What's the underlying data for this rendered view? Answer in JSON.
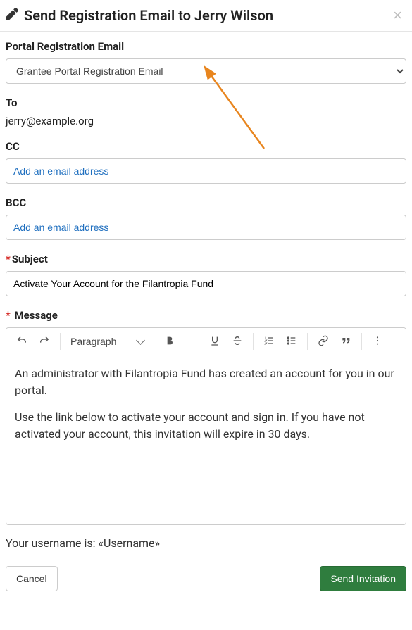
{
  "modal": {
    "title": "Send Registration Email to Jerry Wilson"
  },
  "form": {
    "portal_label": "Portal Registration Email",
    "portal_selected": "Grantee Portal Registration Email",
    "to_label": "To",
    "to_value": "jerry@example.org",
    "cc_label": "CC",
    "cc_placeholder": "Add an email address",
    "bcc_label": "BCC",
    "bcc_placeholder": "Add an email address",
    "subject_label": "Subject",
    "subject_value": "Activate Your Account for the Filantropia Fund",
    "message_label": "Message"
  },
  "editor": {
    "format": "Paragraph",
    "body_p1": "An administrator with Filantropia Fund has created an account for you in our portal.",
    "body_p2": "Use the link below to activate your account and sign in. If you have not activated your account, this invitation will expire in 30 days."
  },
  "post_editor": {
    "username_line": "Your username is: «Username»"
  },
  "footer": {
    "cancel": "Cancel",
    "submit": "Send Invitation"
  }
}
